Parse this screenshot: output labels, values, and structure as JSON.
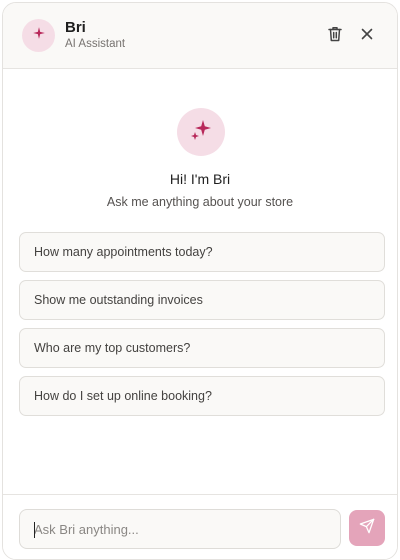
{
  "header": {
    "title": "Bri",
    "subtitle": "AI Assistant",
    "avatar_icon": "sparkle-icon",
    "actions": [
      {
        "icon": "trash-icon"
      },
      {
        "icon": "close-icon"
      }
    ]
  },
  "welcome": {
    "avatar_icon": "sparkle-icon",
    "greeting": "Hi! I'm Bri",
    "tagline": "Ask me anything about your store"
  },
  "suggestions": [
    {
      "label": "How many appointments today?"
    },
    {
      "label": "Show me outstanding invoices"
    },
    {
      "label": "Who are my top customers?"
    },
    {
      "label": "How do I set up online booking?"
    }
  ],
  "composer": {
    "placeholder": "Ask Bri anything...",
    "value": "",
    "send_icon": "send-icon"
  },
  "colors": {
    "accent": "#b8285a",
    "accent_soft": "#f5dde6",
    "send_button": "#e4a4ba"
  }
}
